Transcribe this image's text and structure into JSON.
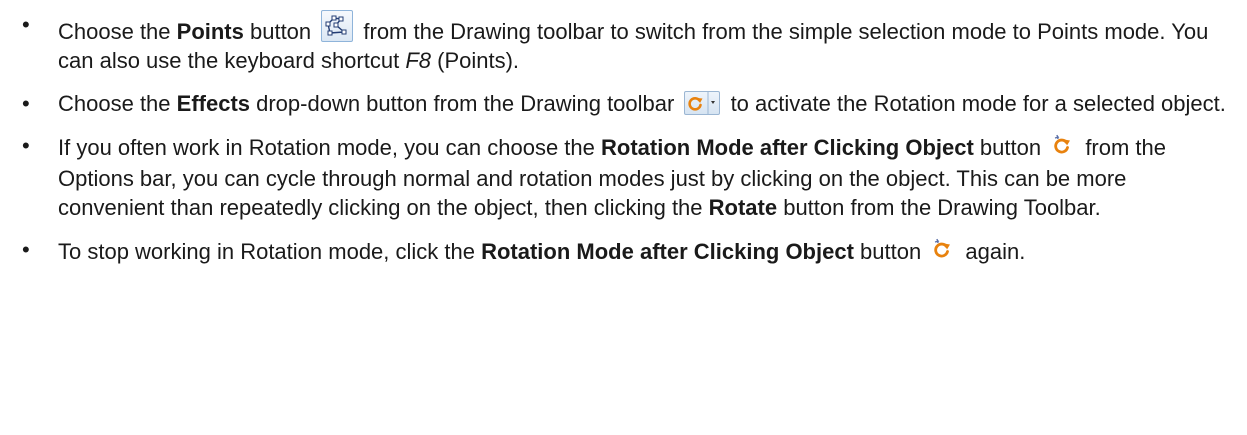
{
  "items": [
    {
      "t1": "Choose the ",
      "b1": "Points",
      "t2": " button ",
      "t3": " from the Drawing toolbar to switch from the simple selection mode to Points mode. You can also use the keyboard shortcut ",
      "i1": "F8",
      "t4": " (Points)."
    },
    {
      "t1": "Choose the ",
      "b1": "Effects",
      "t2": " drop-down button from the Drawing toolbar ",
      "t3": " to activate the Rotation mode for a selected object."
    },
    {
      "t1": "If you often work in Rotation mode, you can choose the ",
      "b1": "Rotation Mode after Clicking Object",
      "t2": " button ",
      "t3": " from the Options bar, you can cycle through normal and rotation modes just by clicking on the object. This can be more convenient than repeatedly clicking on the object, then clicking the ",
      "b2": "Rotate",
      "t4": " button from the Drawing Toolbar."
    },
    {
      "t1": "To stop working in Rotation mode, click the ",
      "b1": "Rotation Mode after Clicking Object",
      "t2": " button ",
      "t3": " again."
    }
  ],
  "icons": {
    "points": "points-icon",
    "effects": "effects-rotate-dropdown-icon",
    "rotation": "rotation-mode-icon"
  }
}
